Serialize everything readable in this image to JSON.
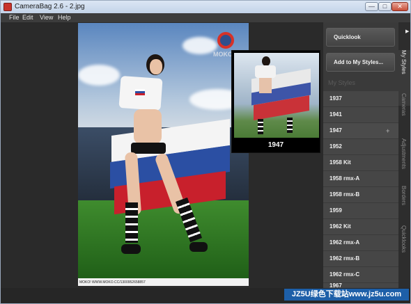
{
  "window": {
    "title": "CameraBag 2.6 - 2.jpg",
    "buttons": {
      "minimize": "—",
      "maximize": "□",
      "close": "✕"
    }
  },
  "menu": [
    "File",
    "Edit",
    "View",
    "Help"
  ],
  "photo": {
    "logo_text": "MOKO",
    "footer_text": "MOKO! WWW.MOKO.CC/1300952658857"
  },
  "preview": {
    "label": "1947"
  },
  "panel": {
    "quicklook_label": "Quicklook",
    "add_styles_label": "Add to My Styles...",
    "my_styles_label": "My Styles",
    "plus_label": "+",
    "styles": [
      "1937",
      "1941",
      "1947",
      "1952",
      "1958 Kit",
      "1958 rmx-A",
      "1958 rmx-B",
      "1959",
      "1962 Kit",
      "1962 rmx-A",
      "1962 rmx-B",
      "1962 rmx-C",
      "1967"
    ],
    "active_style": "1947"
  },
  "tabs": {
    "arrow": "▶",
    "items": [
      "My Styles",
      "Cameras",
      "Adjustments",
      "Borders",
      "Quicklooks"
    ],
    "active": "My Styles"
  },
  "watermark": {
    "text": "JZ5U绿色下载站www.jz5u.com"
  },
  "colors": {
    "watermark_bg": "#1d5fa8",
    "panel_bg": "#3a3a3a",
    "close_button": "#c74e38"
  }
}
